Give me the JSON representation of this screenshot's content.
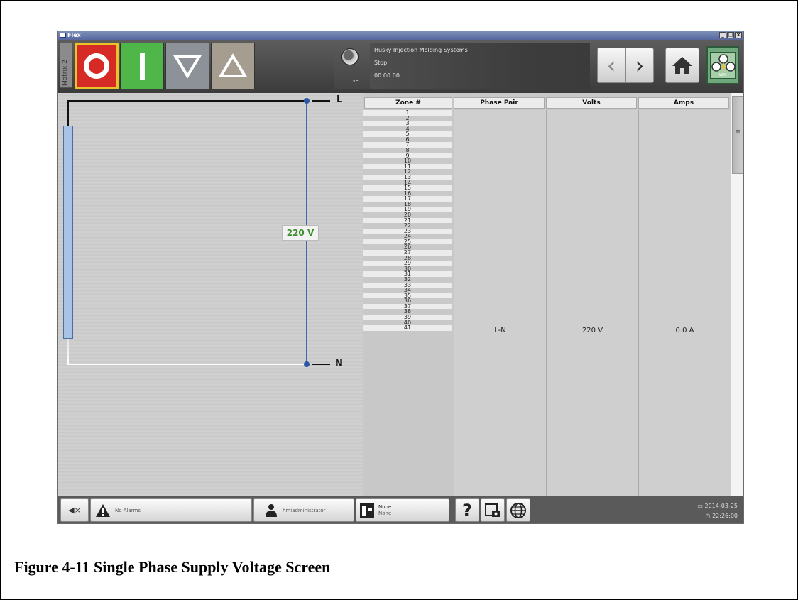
{
  "window": {
    "title": "Flex",
    "controls": [
      "_",
      "□",
      "×"
    ]
  },
  "toolbar": {
    "side_tab": "Matrix 2",
    "temp_unit": "°F",
    "company": "Husky Injection Molding Systems",
    "state": "Stop",
    "timer": "00:00:00",
    "prev_icon": "‹",
    "next_icon": "›",
    "power_label": "kWh"
  },
  "diagram": {
    "line_label": "L",
    "neutral_label": "N",
    "voltage": "220 V"
  },
  "table": {
    "headers": [
      "Zone #",
      "Phase Pair",
      "Volts",
      "Amps"
    ],
    "zones": [
      "1",
      "2",
      "3",
      "4",
      "5",
      "6",
      "7",
      "8",
      "9",
      "10",
      "11",
      "12",
      "13",
      "14",
      "15",
      "16",
      "17",
      "18",
      "19",
      "20",
      "21",
      "22",
      "23",
      "24",
      "25",
      "26",
      "27",
      "28",
      "29",
      "30",
      "31",
      "32",
      "33",
      "34",
      "35",
      "36",
      "37",
      "38",
      "39",
      "40",
      "41"
    ],
    "phase_pair": "L-N",
    "volts": "220 V",
    "amps": "0.0 A",
    "scroll_grip": "≡"
  },
  "statusbar": {
    "mute_icon": "◀×",
    "alarm_text": "No Alarms",
    "user": "hmiadministrator",
    "mold_line1": "None",
    "mold_line2": "None",
    "help": "?",
    "date": "2014-03-25",
    "time": "22:26:00"
  },
  "caption": "Figure 4-11 Single Phase Supply Voltage Screen"
}
